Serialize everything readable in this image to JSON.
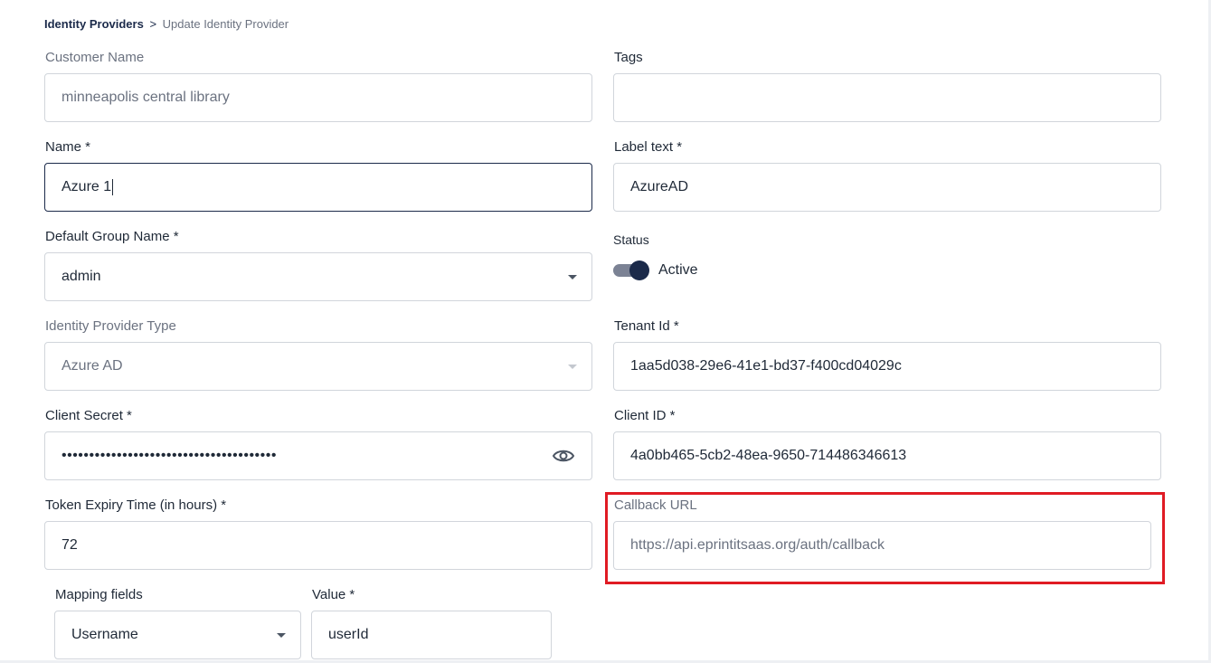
{
  "breadcrumb": {
    "parent": "Identity Providers",
    "separator": ">",
    "current": "Update Identity Provider"
  },
  "form": {
    "customer_name": {
      "label": "Customer Name",
      "value": "minneapolis central library"
    },
    "tags": {
      "label": "Tags",
      "value": ""
    },
    "name": {
      "label": "Name *",
      "value": "Azure 1"
    },
    "label_text": {
      "label": "Label text *",
      "value": "AzureAD"
    },
    "default_group": {
      "label": "Default Group Name *",
      "value": "admin"
    },
    "status": {
      "label": "Status",
      "value": "Active",
      "on": true
    },
    "idp_type": {
      "label": "Identity Provider Type",
      "value": "Azure AD"
    },
    "tenant_id": {
      "label": "Tenant Id *",
      "value": "1aa5d038-29e6-41e1-bd37-f400cd04029c"
    },
    "client_secret": {
      "label": "Client Secret *",
      "value": "•••••••••••••••••••••••••••••••••••••••"
    },
    "client_id": {
      "label": "Client ID *",
      "value": "4a0bb465-5cb2-48ea-9650-714486346613"
    },
    "token_expiry": {
      "label": "Token Expiry Time (in hours) *",
      "value": "72"
    },
    "callback_url": {
      "label": "Callback URL",
      "value": "https://api.eprintitsaas.org/auth/callback"
    },
    "mapping_fields": {
      "label": "Mapping fields",
      "value": "Username"
    },
    "mapping_value": {
      "label": "Value *",
      "value": "userId"
    }
  },
  "colors": {
    "highlight": "#e01b24",
    "primary": "#1b2a4a",
    "border": "#d1d5db"
  },
  "icons": {
    "dropdown": "chevron-down-icon",
    "eye": "eye-icon"
  }
}
